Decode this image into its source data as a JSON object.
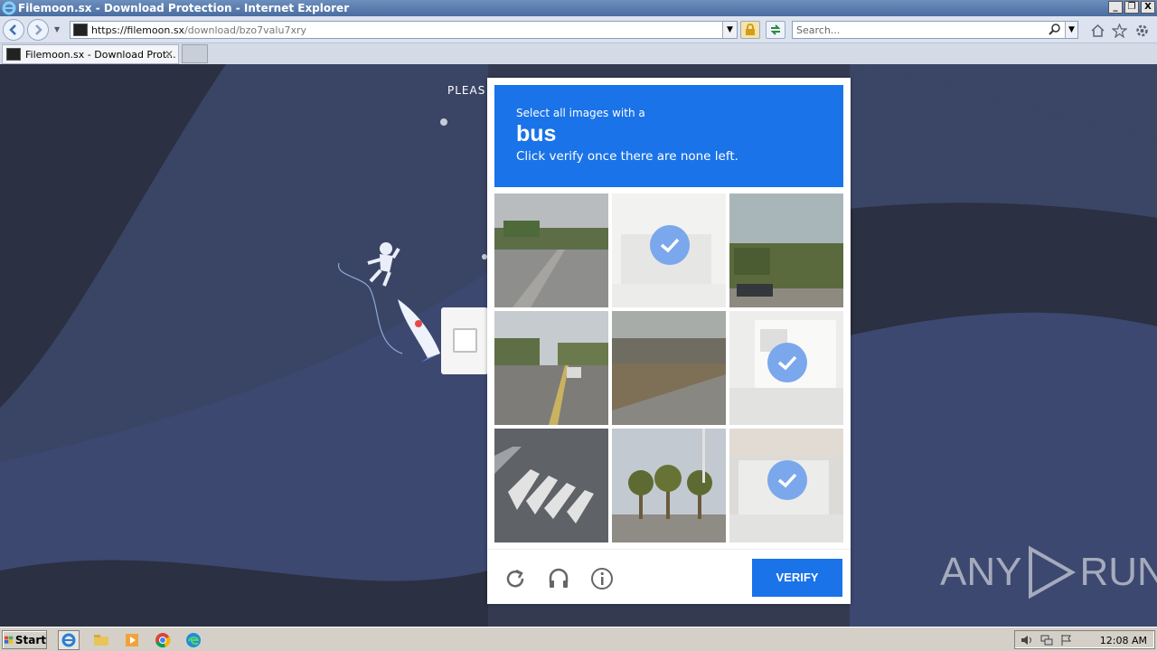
{
  "window": {
    "title": "Filemoon.sx - Download Protection - Internet Explorer",
    "buttons": [
      "_",
      "❐",
      "X"
    ]
  },
  "navbar": {
    "url_domain": "https://filemoon.sx",
    "url_path": "/download/bzo7valu7xry",
    "search_placeholder": "Search..."
  },
  "tabs": [
    {
      "label": "Filemoon.sx - Download Prot...",
      "close": "✕"
    }
  ],
  "page": {
    "please_text": "PLEAS"
  },
  "captcha": {
    "prompt_line1": "Select all images with a",
    "target_word": "bus",
    "prompt_line3": "Click verify once there are none left.",
    "tiles": [
      {
        "selected": false,
        "scene": "road-with-trees"
      },
      {
        "selected": true,
        "scene": "bus-faded"
      },
      {
        "selected": false,
        "scene": "trees-and-car"
      },
      {
        "selected": false,
        "scene": "street-intersection"
      },
      {
        "selected": false,
        "scene": "bridge-over-road"
      },
      {
        "selected": true,
        "scene": "bus-white"
      },
      {
        "selected": false,
        "scene": "crosswalk"
      },
      {
        "selected": false,
        "scene": "palm-trees"
      },
      {
        "selected": true,
        "scene": "bus-parked"
      }
    ],
    "verify_label": "VERIFY",
    "accent_color": "#1a73e8"
  },
  "watermark": {
    "left": "ANY",
    "right": "RUN"
  },
  "taskbar": {
    "start_label": "Start",
    "clock": "12:08 AM"
  }
}
